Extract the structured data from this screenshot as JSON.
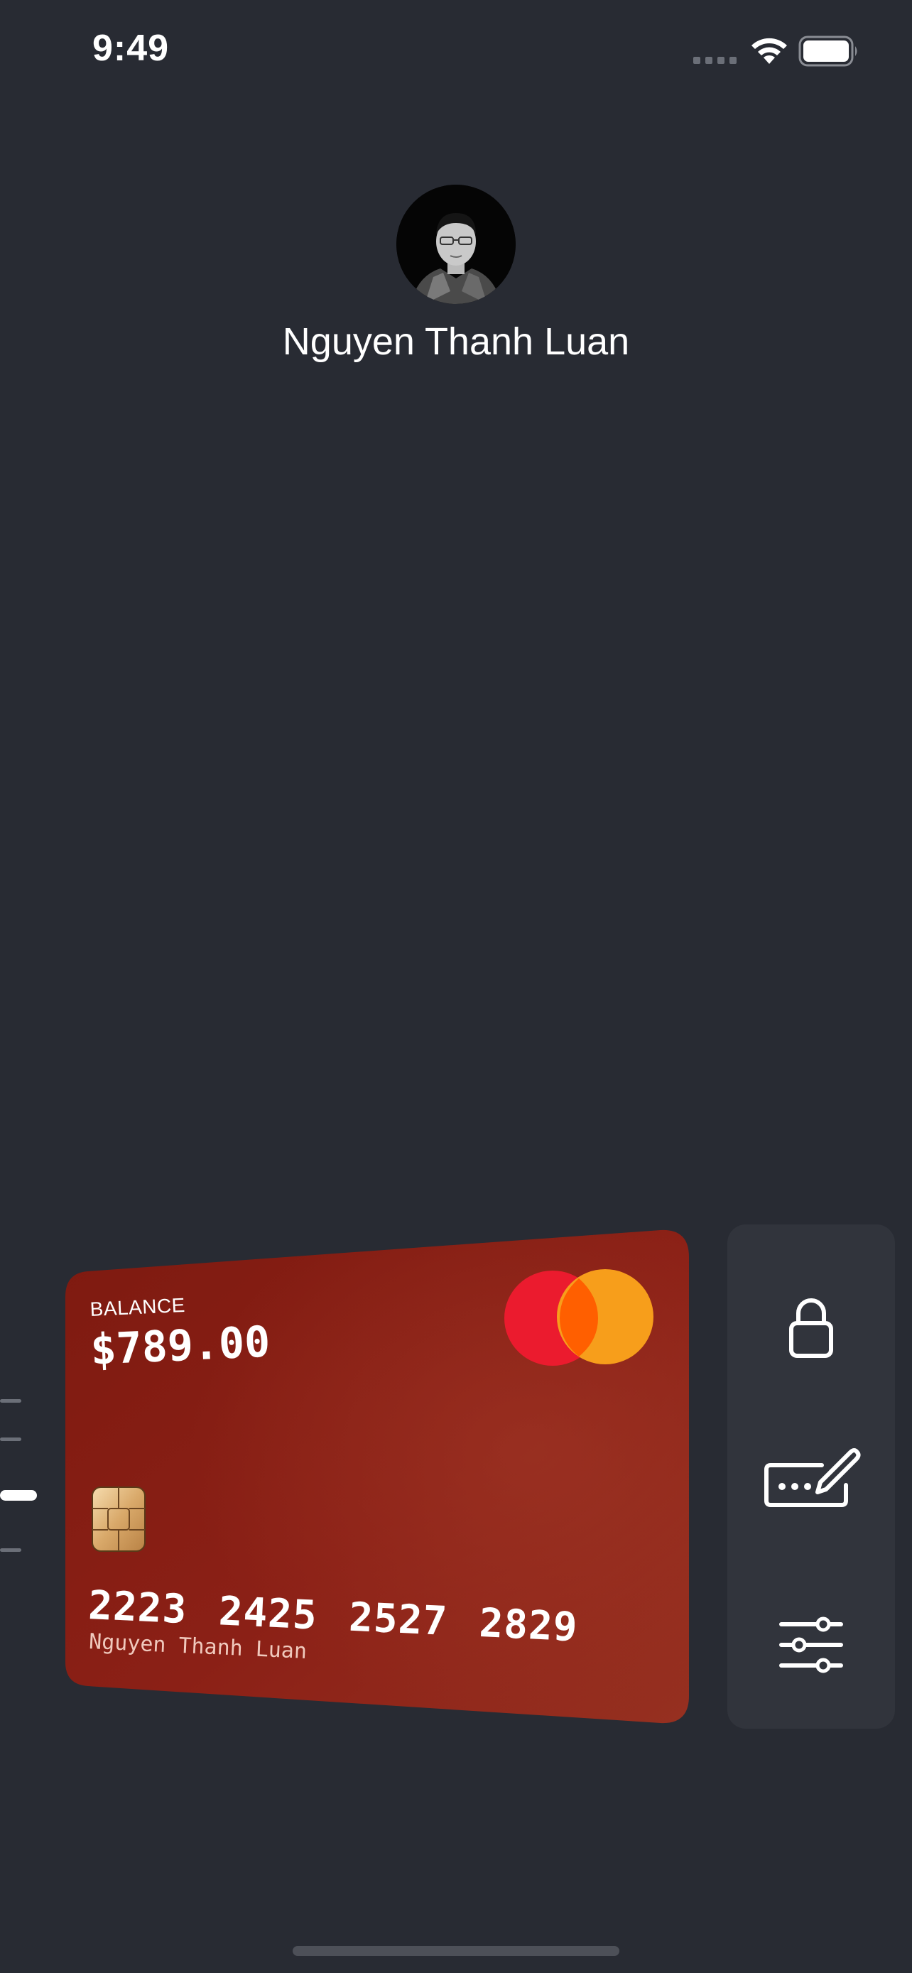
{
  "status_bar": {
    "time": "9:49",
    "icons": [
      "signal-icon",
      "wifi-icon",
      "battery-icon"
    ]
  },
  "profile": {
    "name": "Nguyen Thanh Luan",
    "avatar": "avatar-photo"
  },
  "card": {
    "balance_label": "BALANCE",
    "balance": "$789.00",
    "number": "2223 2425 2527 2829",
    "holder": "Nguyen Thanh Luan",
    "brand_icon": "mastercard-logo",
    "chip_icon": "chip-icon",
    "colors": {
      "card": "#8a1e14",
      "mc_red": "#eb1b2e",
      "mc_orange": "#f79e1b",
      "mc_overlap": "#ff5f00"
    }
  },
  "card_pager": {
    "count": 4,
    "active_index": 2
  },
  "actions": [
    {
      "name": "lock-button",
      "icon": "lock-icon"
    },
    {
      "name": "edit-pin-button",
      "icon": "edit-pin-icon"
    },
    {
      "name": "settings-button",
      "icon": "sliders-icon"
    }
  ],
  "theme": {
    "background": "#282b33",
    "panel": "#31343c"
  }
}
